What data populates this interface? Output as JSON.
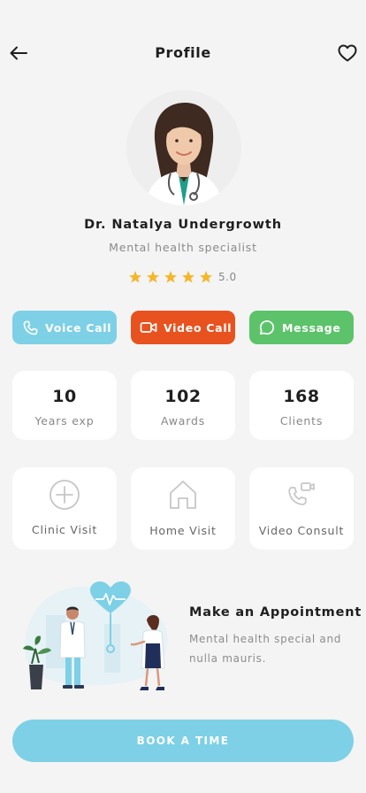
{
  "header": {
    "title": "Profile"
  },
  "doctor": {
    "name": "Dr. Natalya Undergrowth",
    "specialty": "Mental health specialist",
    "rating": "5.0",
    "stars": 5
  },
  "actions": {
    "voice_label": "Voice Call",
    "video_label": "Video Call",
    "message_label": "Message"
  },
  "stats": [
    {
      "value": "10",
      "label": "Years exp"
    },
    {
      "value": "102",
      "label": "Awards"
    },
    {
      "value": "168",
      "label": "Clients"
    }
  ],
  "services": [
    {
      "label": "Clinic Visit",
      "icon": "plus-circle-icon"
    },
    {
      "label": "Home Visit",
      "icon": "home-icon"
    },
    {
      "label": "Video Consult",
      "icon": "video-call-icon"
    }
  ],
  "appointment": {
    "title": "Make an Appointment",
    "description": "Mental health special and nulla mauris."
  },
  "book_button": {
    "label": "BOOK A TIME"
  },
  "colors": {
    "voice": "#7dd0e6",
    "video": "#e8521f",
    "message": "#5cc36a",
    "star": "#f5b62a",
    "primary": "#7dd0e6"
  }
}
